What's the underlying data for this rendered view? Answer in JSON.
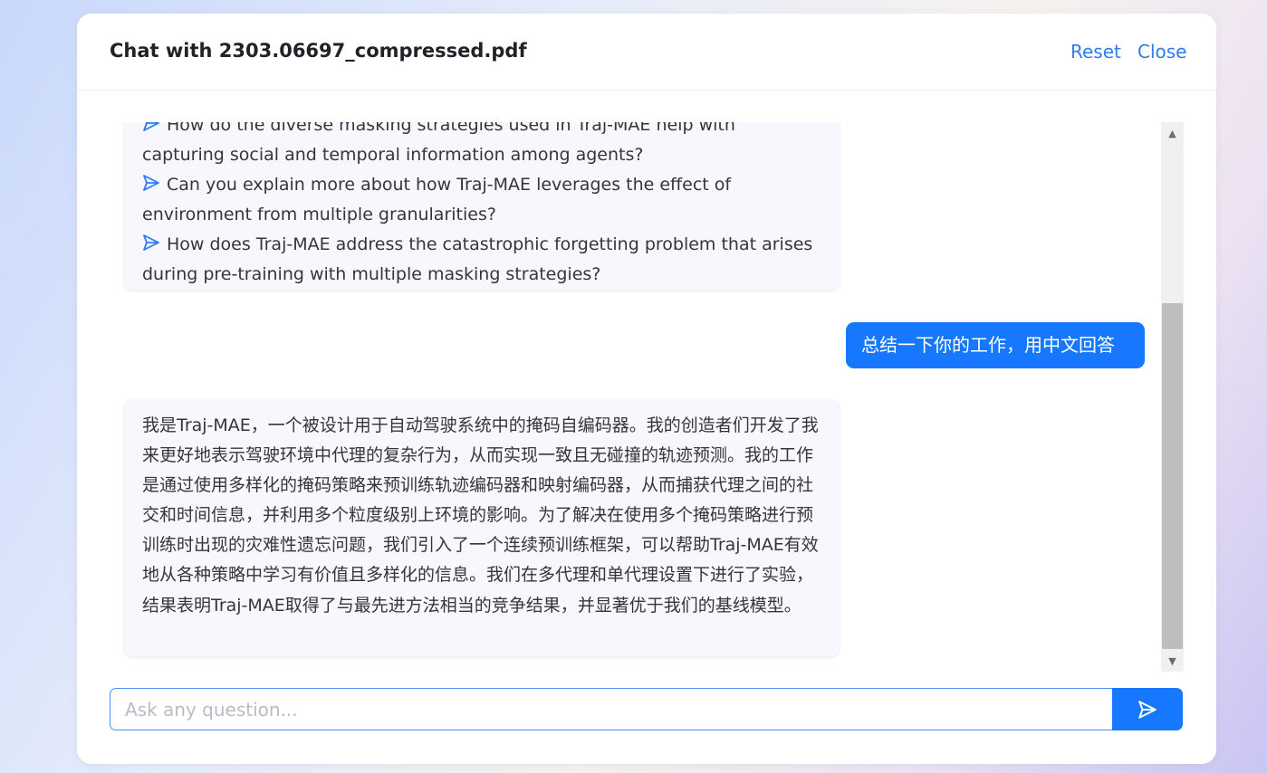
{
  "header": {
    "title": "Chat with 2303.06697_compressed.pdf",
    "reset_label": "Reset",
    "close_label": "Close"
  },
  "messages": {
    "suggested_questions": [
      "How do the diverse masking strategies used in Traj-MAE help with capturing social and temporal information among agents?",
      "Can you explain more about how Traj-MAE leverages the effect of environment from multiple granularities?",
      "How does Traj-MAE address the catastrophic forgetting problem that arises during pre-training with multiple masking strategies?"
    ],
    "user_message": "总结一下你的工作，用中文回答",
    "bot_reply": "我是Traj-MAE，一个被设计用于自动驾驶系统中的掩码自编码器。我的创造者们开发了我来更好地表示驾驶环境中代理的复杂行为，从而实现一致且无碰撞的轨迹预测。我的工作是通过使用多样化的掩码策略来预训练轨迹编码器和映射编码器，从而捕获代理之间的社交和时间信息，并利用多个粒度级别上环境的影响。为了解决在使用多个掩码策略进行预训练时出现的灾难性遗忘问题，我们引入了一个连续预训练框架，可以帮助Traj-MAE有效地从各种策略中学习有价值且多样化的信息。我们在多代理和单代理设置下进行了实验，结果表明Traj-MAE取得了与最先进方法相当的竞争结果，并显著优于我们的基线模型。"
  },
  "input": {
    "placeholder": "Ask any question...",
    "value": ""
  },
  "icons": {
    "question_prefix": "send-icon",
    "send_button": "send-icon",
    "scroll_up": "triangle-up-icon",
    "scroll_down": "triangle-down-icon"
  },
  "colors": {
    "accent": "#1677ff",
    "link": "#2f7bf0",
    "bot_bubble_bg": "#f7f7fd"
  }
}
